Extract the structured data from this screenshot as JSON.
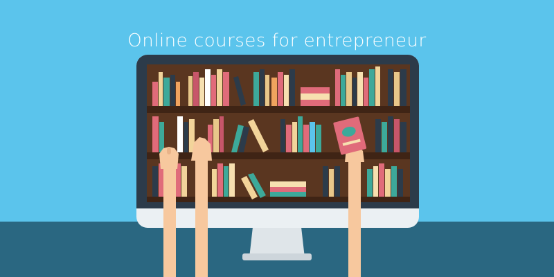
{
  "headline": "Online courses for entrepreneur",
  "colors": {
    "sky": "#5bc4ec",
    "desk": "#2a6781",
    "monitor_frame": "#2c3b4a",
    "monitor_chin": "#ebf0f3",
    "shelf_wood": "#5a3620",
    "shelf_plank": "#3f2415",
    "skin": "#f7c89e",
    "held_book": "#e06b7a"
  },
  "icons": [
    "bookshelf-illustration",
    "computer-monitor",
    "raised-hands"
  ]
}
